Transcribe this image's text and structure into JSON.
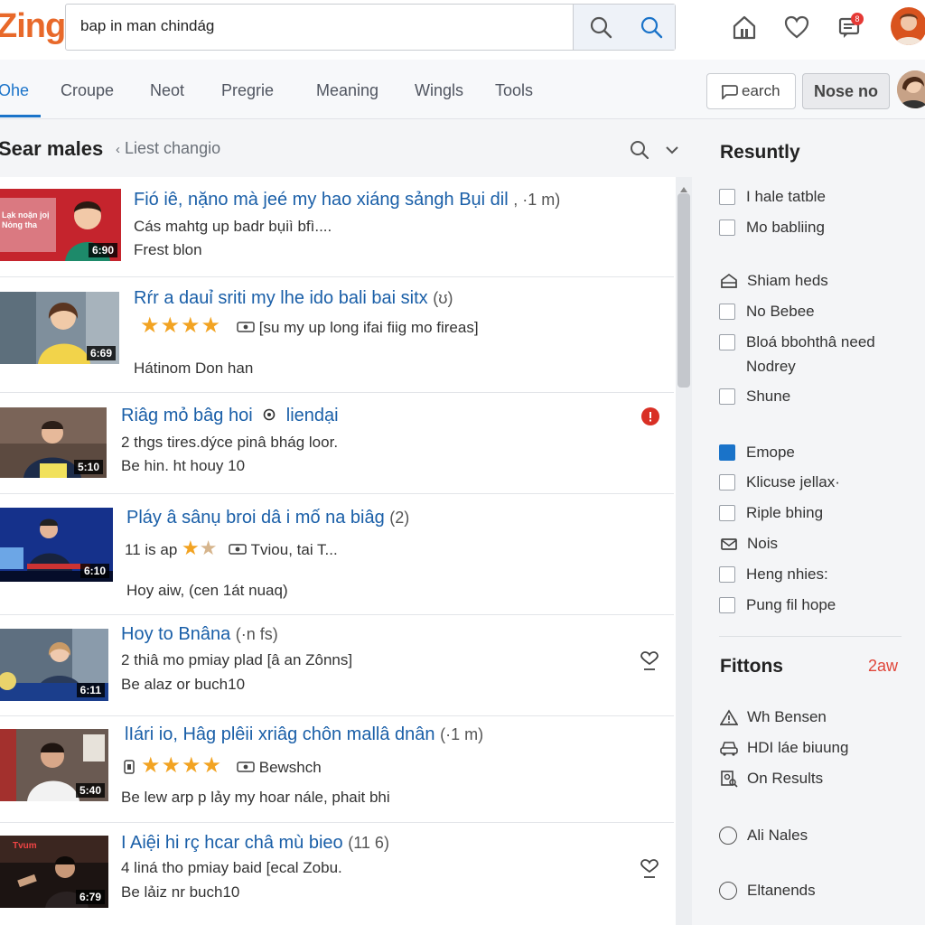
{
  "header": {
    "logo": "Zing",
    "search_value": "bap in man chindág",
    "notification_count": "8"
  },
  "tabs": [
    "Ohe",
    "Croupe",
    "Neot",
    "Pregrie",
    "Meaning",
    "Wingls",
    "Tools"
  ],
  "actions": {
    "search_label": "earch",
    "primary_label": "Nose no"
  },
  "results": {
    "title": "Sear males",
    "crumb": "Liest changio"
  },
  "items": [
    {
      "title": "Fió iê, nặno mà jeé my hao xiáng sảngh Bụi dil",
      "suffix": ", ·1 m)",
      "line1": "Cás mahtg up badr bụiì bfì....",
      "line2": "Frest blon",
      "duration": "6:90",
      "thumb_caption": "Lạk noặn joị Nỏng tha"
    },
    {
      "title": "Rŕr a dauỉ sriti my lhe ido bali bai sitx",
      "suffix": "(ʊ)",
      "rating": 4,
      "meta": "[su my up long ifai fiig mo fireas]",
      "line2": "Hátinom Don han",
      "duration": "6:69"
    },
    {
      "title": "Riâg mỏ bâg hoi",
      "title2": "liendại",
      "line1": "2 thgs tires.dýce pinâ bhág loor.",
      "line2": "Be hin. ht houy 10",
      "duration": "5:10"
    },
    {
      "title": "Pláy â sânụ broi dâ i mố na biâg",
      "suffix": "(2)",
      "meta_prefix": "11 is ap",
      "rating": 1.5,
      "meta": "Tviou, tai T...",
      "line2": "Hoy aiw, (cen 1át nuaq)",
      "duration": "6:10"
    },
    {
      "title": "Hoy to Bnâna",
      "suffix": "(·n fs)",
      "line1": "2 thiâ mo pmiay plad [â an Zônns]",
      "line2": "Be alaz or buch10",
      "duration": "6:11"
    },
    {
      "title": "lIári io, Hâg plêii xriâg chôn mallâ dnân",
      "suffix": "(·1 m)",
      "rating": 4,
      "meta": "Bewshch",
      "line2": "Be lew arp p lảy my hoar nále, phait bhi",
      "duration": "5:40"
    },
    {
      "title": "I Aiệi hi rç hcar châ mù bieo",
      "suffix": "(11 6)",
      "line1": "4 liná tho pmiay baid [ecal Zobu.",
      "line2": "Be lảiz nr buch10",
      "duration": "6:79",
      "thumb_caption": "Tvum"
    }
  ],
  "panel": {
    "section1_title": "Resuntly",
    "checks_a": [
      "I hale tatble",
      "Mo babliing"
    ],
    "icon_row_a": "Shiam heds",
    "checks_b": [
      "No Bebee",
      "Bloá bbohthâ need Nodrey",
      "Shune"
    ],
    "emope": "Emope",
    "checks_c": [
      "Klicuse jellax·",
      "Riple bhing"
    ],
    "icon_row_b": "Nois",
    "checks_d": [
      "Heng nhies:",
      "Pung fil hope"
    ],
    "section2_title": "Fittons",
    "section2_link": "2aw",
    "icon_rows": [
      "Wh Bensen",
      "HDI láe biuung",
      "On Results"
    ],
    "radios": [
      "Ali Nales",
      "Eltanends"
    ]
  }
}
